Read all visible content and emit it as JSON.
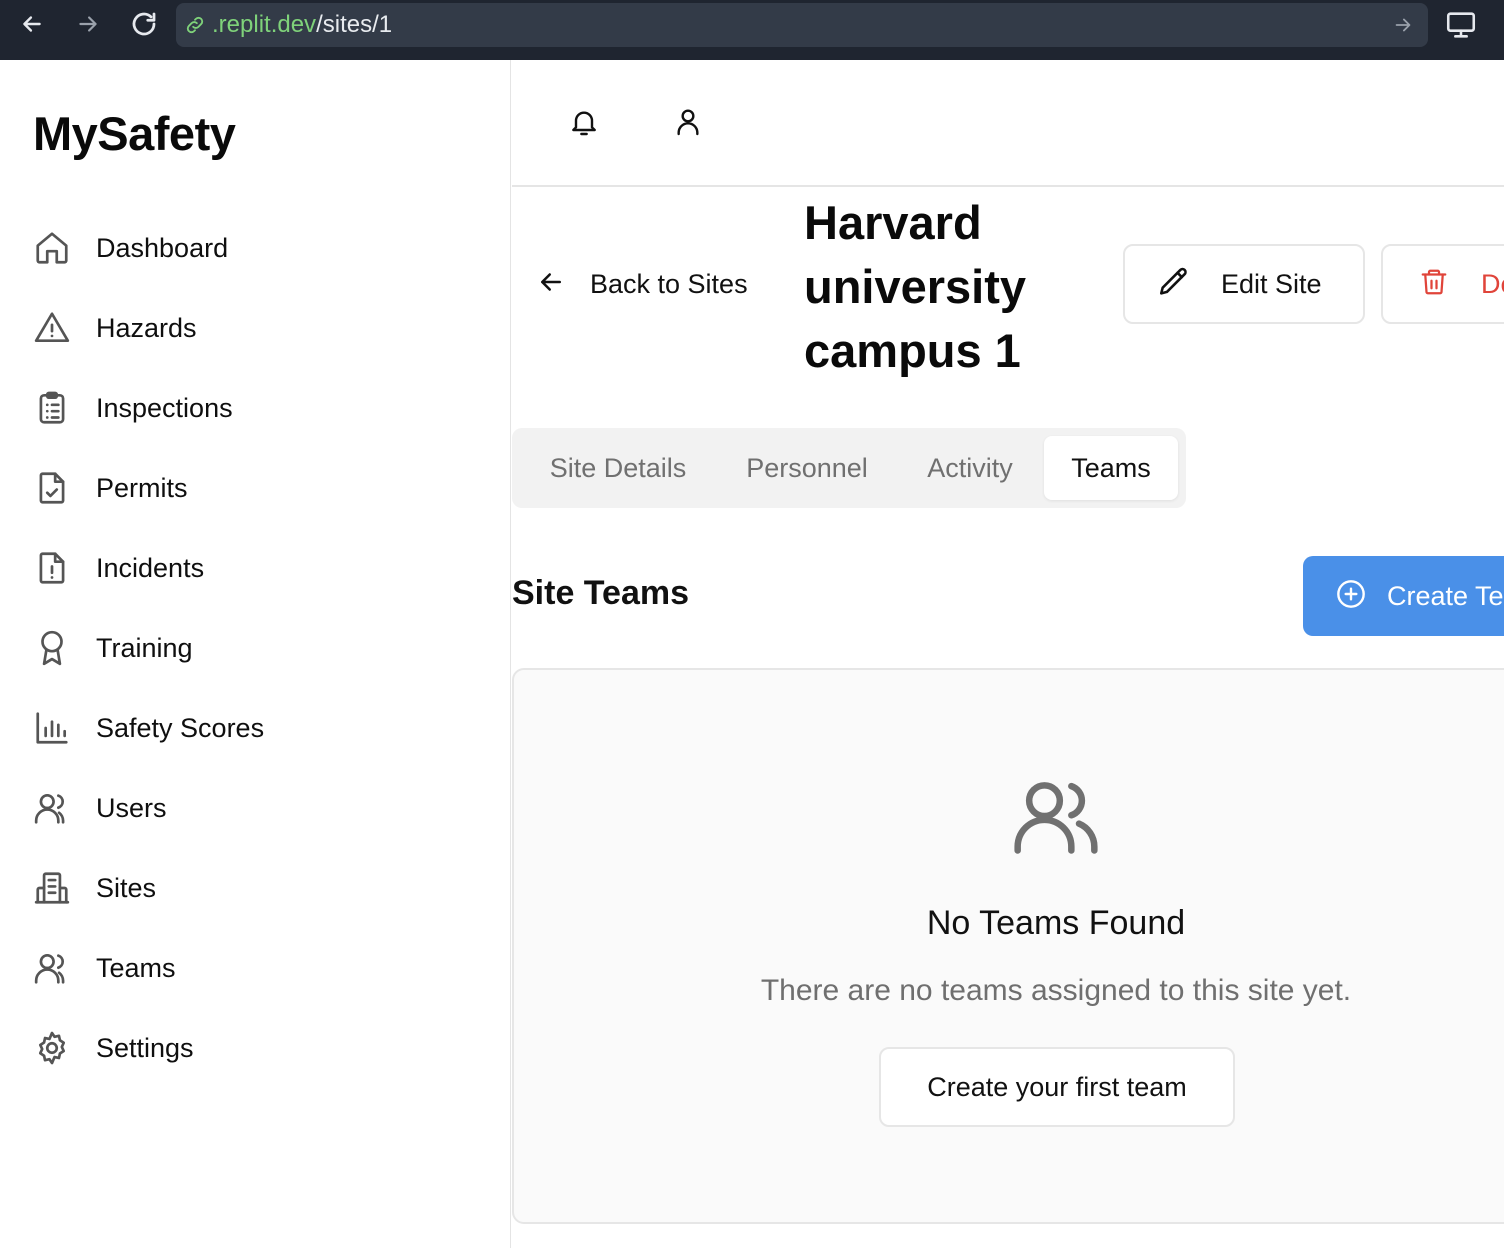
{
  "browser": {
    "url_host": ".replit.dev",
    "url_path": "/sites/1",
    "icons": [
      "back-arrow-icon",
      "forward-arrow-icon",
      "reload-icon",
      "link-icon",
      "go-arrow-icon",
      "desktop-icon"
    ]
  },
  "sidebar": {
    "logo": "MySafety",
    "items": [
      {
        "label": "Dashboard",
        "icon": "home-icon"
      },
      {
        "label": "Hazards",
        "icon": "warning-triangle-icon"
      },
      {
        "label": "Inspections",
        "icon": "clipboard-list-icon"
      },
      {
        "label": "Permits",
        "icon": "file-check-icon"
      },
      {
        "label": "Incidents",
        "icon": "file-alert-icon"
      },
      {
        "label": "Training",
        "icon": "award-icon"
      },
      {
        "label": "Safety Scores",
        "icon": "bar-chart-icon"
      },
      {
        "label": "Users",
        "icon": "users-icon"
      },
      {
        "label": "Sites",
        "icon": "building-icon"
      },
      {
        "label": "Teams",
        "icon": "users-icon"
      },
      {
        "label": "Settings",
        "icon": "gear-icon"
      }
    ]
  },
  "header": {
    "icons": [
      "bell-icon",
      "user-icon"
    ]
  },
  "page": {
    "back_label": "Back to Sites",
    "title": "Harvard university campus 1",
    "edit_label": "Edit Site",
    "delete_label": "Delete"
  },
  "tabs": [
    {
      "label": "Site Details",
      "active": false
    },
    {
      "label": "Personnel",
      "active": false
    },
    {
      "label": "Activity",
      "active": false
    },
    {
      "label": "Teams",
      "active": true
    }
  ],
  "teams_section": {
    "title": "Site Teams",
    "create_label": "Create Team",
    "empty_title": "No Teams Found",
    "empty_message": "There are no teams assigned to this site yet.",
    "first_team_label": "Create your first team"
  },
  "colors": {
    "primary": "#4a90e8",
    "danger": "#e0443a",
    "browser_bar": "#1f2530",
    "url_host": "#7fd27a"
  }
}
